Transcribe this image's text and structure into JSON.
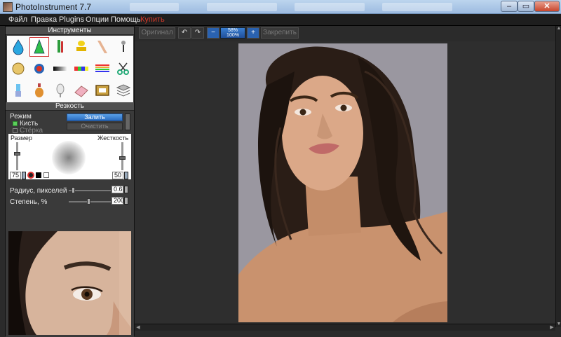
{
  "window": {
    "title": "PhotoInstrument 7.7"
  },
  "menu": [
    "Файл",
    "Правка",
    "Plugins",
    "Опции",
    "Помощь"
  ],
  "menu_buy": "Купить",
  "tools_header": "Инструменты",
  "tools": [
    "drop-icon",
    "cone-icon",
    "tube-icon",
    "stamp-icon",
    "smudge-icon",
    "pin-icon",
    "face-icon",
    "eye-icon",
    "gradient-bar-icon",
    "color-bar-icon",
    "rainbow-icon",
    "scissors-icon",
    "lipstick-icon",
    "bottle-icon",
    "mirror-icon",
    "eraser-icon",
    "frame-icon",
    "layers-icon"
  ],
  "sharpness": {
    "header": "Резкость",
    "mode_label": "Режим",
    "brush_label": "Кисть",
    "eraser_label": "Стёрка",
    "fill_button": "Залить",
    "clear_button": "Очистить",
    "size_label": "Размер",
    "hardness_label": "Жесткость",
    "size_value": "75",
    "hardness_value": "50",
    "radius_label": "Радиус, пикселей",
    "radius_value": "0.6",
    "degree_label": "Степень, %",
    "degree_value": "200"
  },
  "toolbar": {
    "original": "Оригинал",
    "zoom_top": "58%",
    "zoom_bottom": "100%",
    "pin": "Закрепить"
  },
  "colors": {
    "accent": "#2a6cc0",
    "buy": "#d43a2a",
    "selected_tool": "#d23c3c"
  }
}
